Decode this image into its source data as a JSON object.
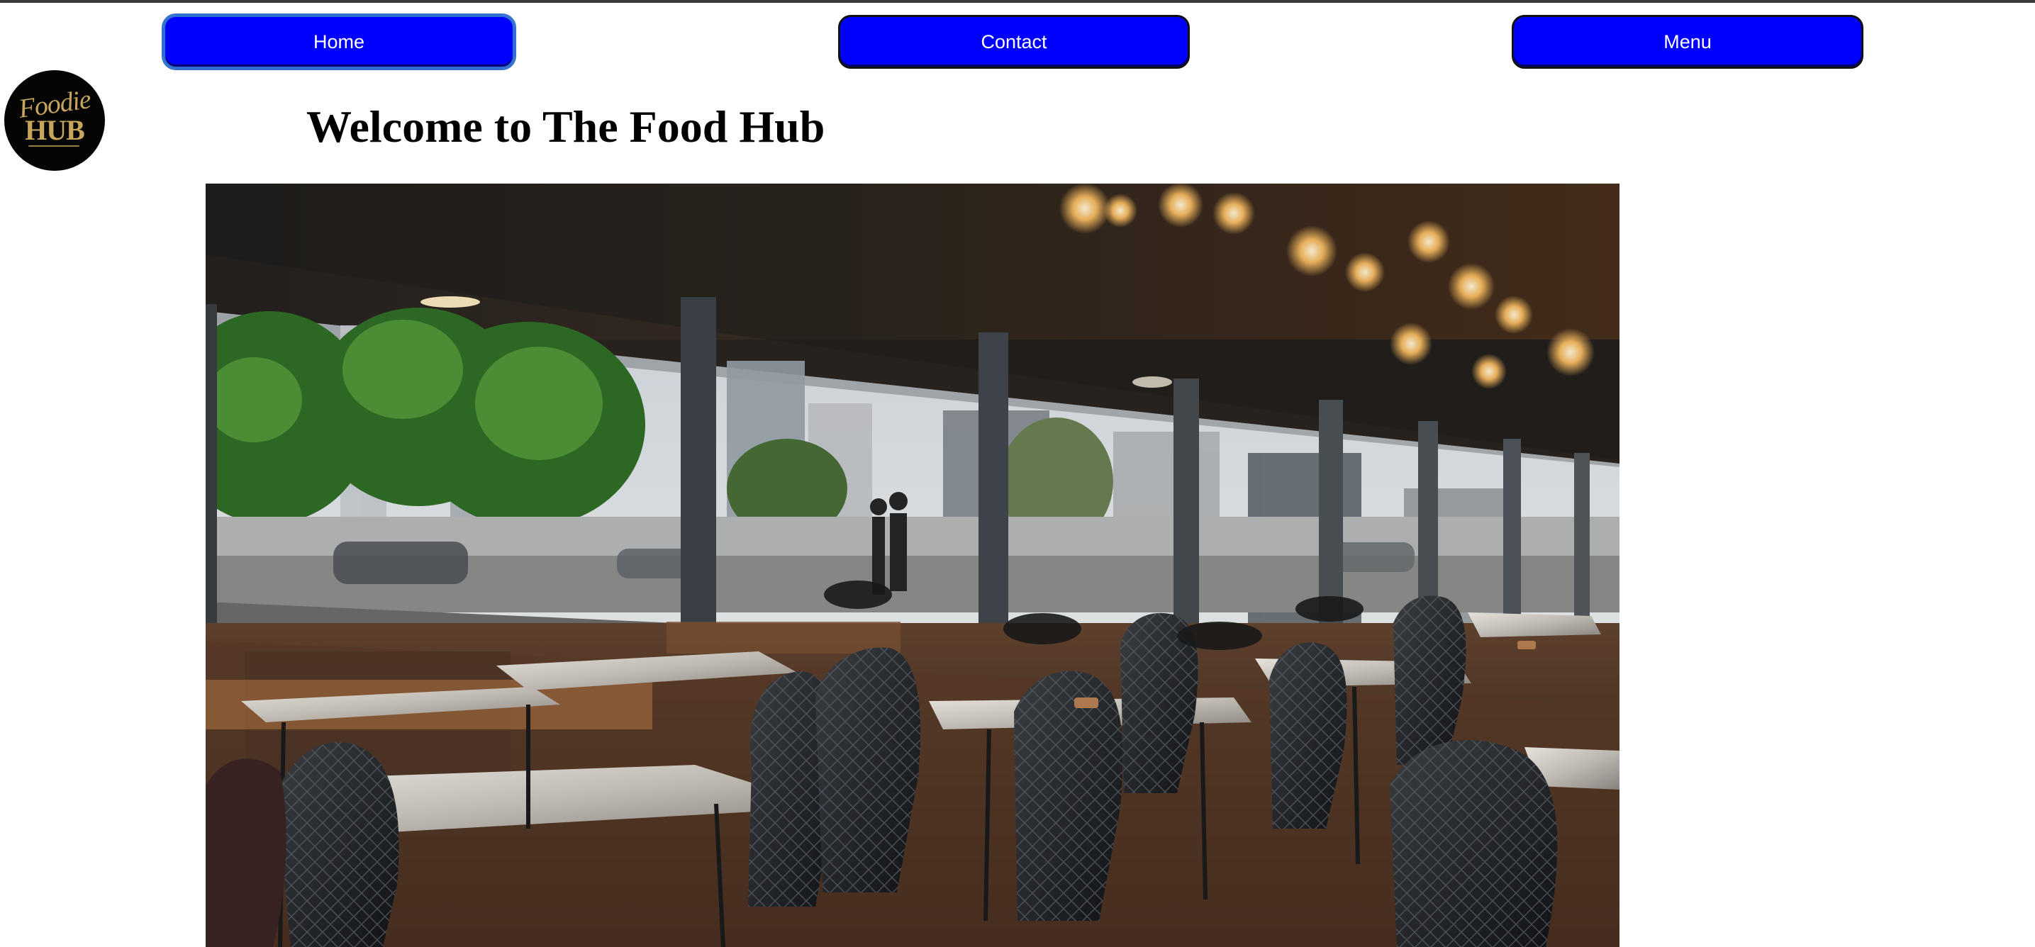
{
  "nav": {
    "home_label": "Home",
    "contact_label": "Contact",
    "menu_label": "Menu"
  },
  "logo": {
    "script_text": "Foodie",
    "hub_text": "HUB"
  },
  "heading": {
    "title": "Welcome to The Food Hub"
  },
  "colors": {
    "nav_button": "#0000ff",
    "logo_background": "#050505",
    "logo_gold": "#c8a55c"
  }
}
